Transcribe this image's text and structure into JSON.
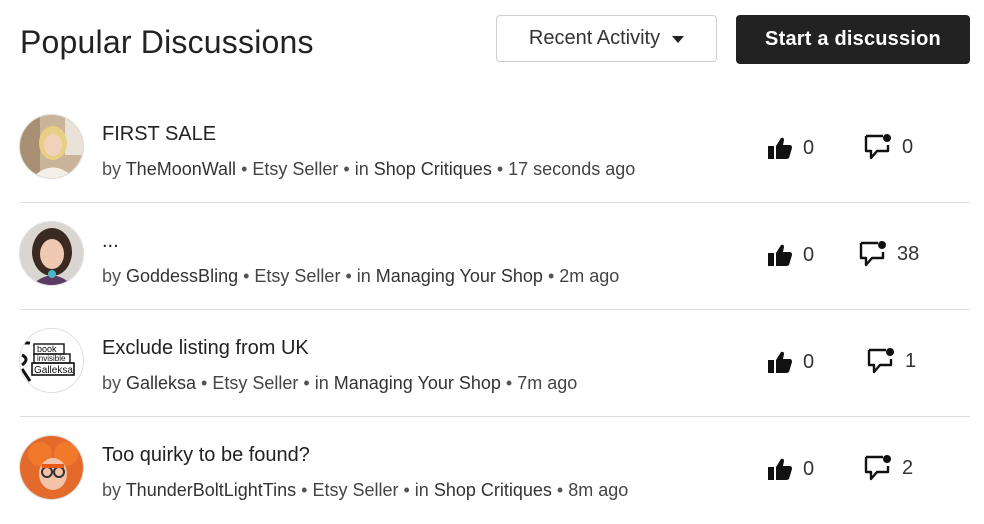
{
  "header": {
    "title": "Popular Discussions",
    "sort_label": "Recent Activity",
    "start_button_label": "Start a discussion"
  },
  "threads": [
    {
      "title": "FIRST SALE",
      "author": "TheMoonWall",
      "role": "Etsy Seller",
      "category_prefix": "in",
      "category": "Shop Critiques",
      "time": "17 seconds ago",
      "likes": "0",
      "replies": "0",
      "avatar_icon": "avatar-photo-blonde"
    },
    {
      "title": "...",
      "author": "GoddessBling",
      "role": "Etsy Seller",
      "category_prefix": "in",
      "category": "Managing Your Shop",
      "time": "2m ago",
      "likes": "0",
      "replies": "38",
      "avatar_icon": "avatar-photo-brunette"
    },
    {
      "title": "Exclude listing from UK",
      "author": "Galleksa",
      "role": "Etsy Seller",
      "category_prefix": "in",
      "category": "Managing Your Shop",
      "time": "7m ago",
      "likes": "0",
      "replies": "1",
      "avatar_icon": "avatar-logo-text",
      "avatar_lines": [
        "book",
        "invisible",
        "Galleksa"
      ]
    },
    {
      "title": "Too quirky to be found?",
      "author": "ThunderBoltLightTins",
      "role": "Etsy Seller",
      "category_prefix": "in",
      "category": "Shop Critiques",
      "time": "8m ago",
      "likes": "0",
      "replies": "2",
      "avatar_icon": "avatar-photo-redhead"
    }
  ],
  "icons": {
    "like": "thumbs-up-icon",
    "replies": "speech-bubble-icon"
  },
  "colors": {
    "button_bg": "#222222",
    "button_text": "#ffffff",
    "divider": "#dddddd"
  }
}
